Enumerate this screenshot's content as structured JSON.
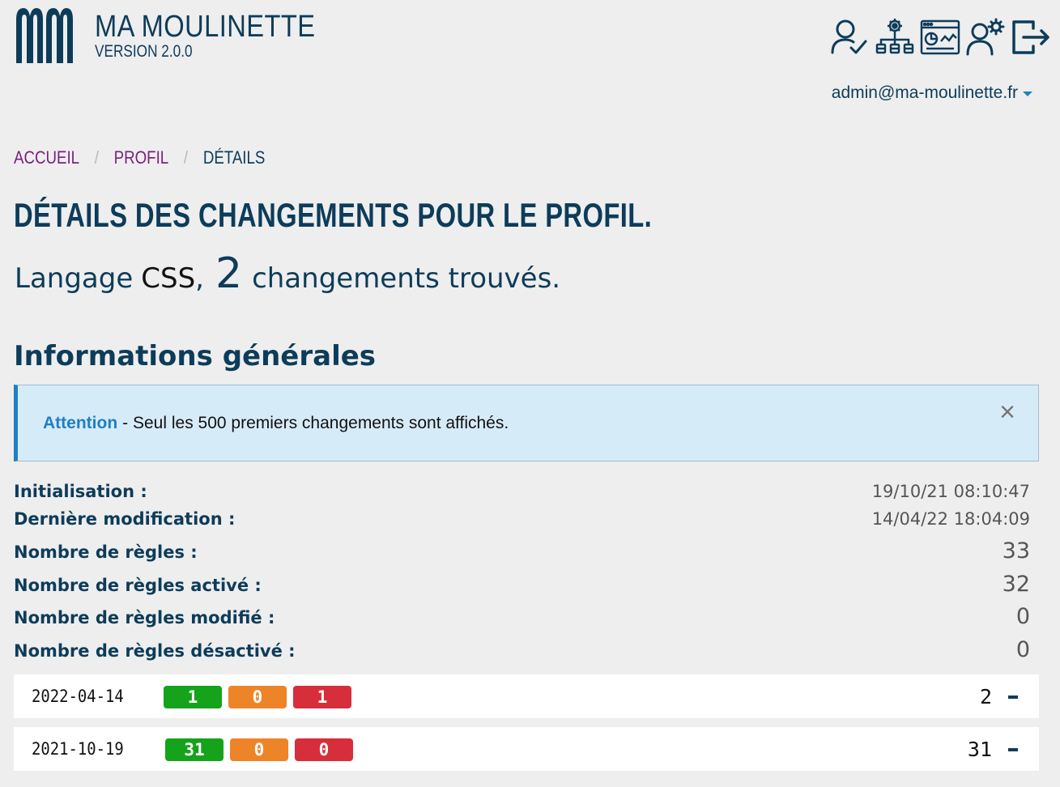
{
  "header": {
    "app_name": "MA MOULINETTE",
    "version": "VERSION 2.0.0",
    "icons": [
      "user-check-icon",
      "org-settings-icon",
      "dashboard-icon",
      "users-settings-icon",
      "logout-icon"
    ],
    "user_email": "admin@ma-moulinette.fr"
  },
  "breadcrumb": {
    "items": [
      "ACCUEIL",
      "PROFIL",
      "DÉTAILS"
    ]
  },
  "page": {
    "title": "DÉTAILS DES CHANGEMENTS POUR LE PROFIL.",
    "summary_prefix": "Langage",
    "language": "CSS",
    "comma": ",",
    "change_count": "2",
    "summary_suffix": "changements trouvés.",
    "section_title": "Informations générales"
  },
  "alert": {
    "strong": "Attention",
    "message": "- Seul les 500 premiers changements sont affichés.",
    "close": "×"
  },
  "info": [
    {
      "label": "Initialisation :",
      "value": "19/10/21 08:10:47"
    },
    {
      "label": "Dernière modification :",
      "value": "14/04/22 18:04:09"
    },
    {
      "label": "Nombre de règles :",
      "value": "33"
    },
    {
      "label": "Nombre de règles activé :",
      "value": "32"
    },
    {
      "label": "Nombre de règles modifié :",
      "value": "0"
    },
    {
      "label": "Nombre de règles désactivé :",
      "value": "0"
    }
  ],
  "history": [
    {
      "date": "2022-04-14",
      "activated": "1",
      "modified": "0",
      "deactivated": "1",
      "total": "2"
    },
    {
      "date": "2021-10-19",
      "activated": "31",
      "modified": "0",
      "deactivated": "0",
      "total": "31"
    }
  ],
  "colors": {
    "primary": "#0d3c5a",
    "link": "#7a1f7f",
    "accent": "#1f7fc4",
    "green": "#14a31b",
    "orange": "#ee8428",
    "red": "#d62e3a"
  }
}
